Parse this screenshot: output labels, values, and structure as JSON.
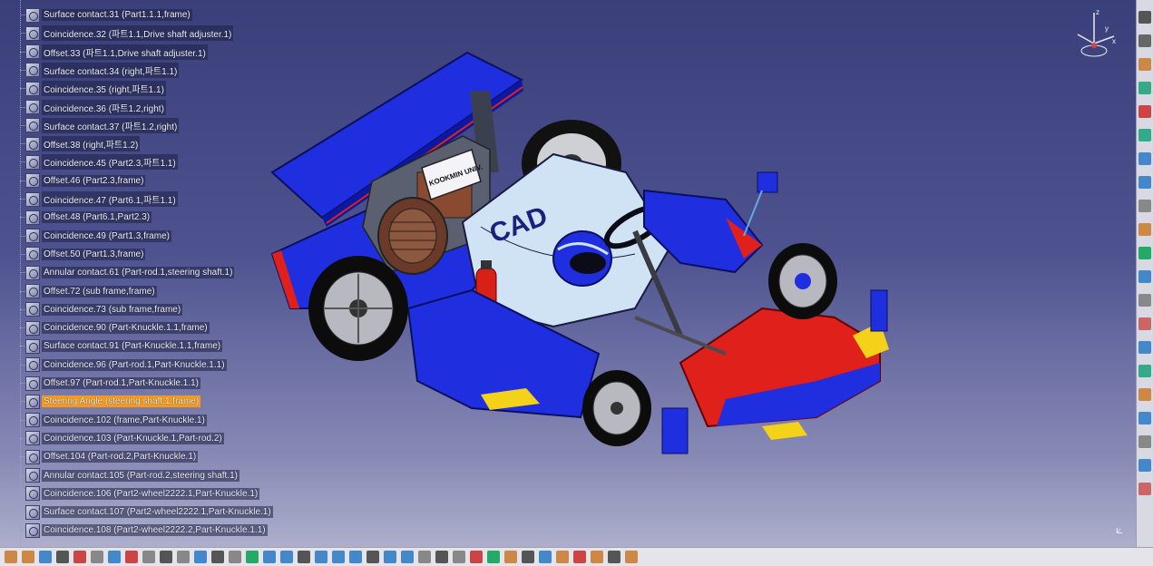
{
  "tree": {
    "items": [
      {
        "label": "Surface contact.31 (Part1.1.1,frame)"
      },
      {
        "label": "Coincidence.32 (파트1.1,Drive shaft adjuster.1)"
      },
      {
        "label": "Offset.33 (파트1.1,Drive shaft adjuster.1)"
      },
      {
        "label": "Surface contact.34 (right,파트1.1)"
      },
      {
        "label": "Coincidence.35 (right,파트1.1)"
      },
      {
        "label": "Coincidence.36 (파트1.2,right)"
      },
      {
        "label": "Surface contact.37 (파트1.2,right)"
      },
      {
        "label": "Offset.38 (right,파트1.2)"
      },
      {
        "label": "Coincidence.45 (Part2.3,파트1.1)"
      },
      {
        "label": "Offset.46 (Part2.3,frame)"
      },
      {
        "label": "Coincidence.47 (Part6.1,파트1.1)"
      },
      {
        "label": "Offset.48 (Part6.1,Part2.3)"
      },
      {
        "label": "Coincidence.49 (Part1.3,frame)"
      },
      {
        "label": "Offset.50 (Part1.3,frame)"
      },
      {
        "label": "Annular contact.61 (Part-rod.1,steering shaft.1)"
      },
      {
        "label": "Offset.72 (sub frame,frame)"
      },
      {
        "label": "Coincidence.73 (sub frame,frame)"
      },
      {
        "label": "Coincidence.90 (Part-Knuckle.1.1,frame)"
      },
      {
        "label": "Surface contact.91 (Part-Knuckle.1.1,frame)"
      },
      {
        "label": "Coincidence.96 (Part-rod.1,Part-Knuckle.1.1)"
      },
      {
        "label": "Offset.97 (Part-rod.1,Part-Knuckle.1.1)"
      },
      {
        "label": "Steering Angle (steering shaft.1,frame)",
        "selected": true
      },
      {
        "label": "Coincidence.102 (frame,Part-Knuckle.1)"
      },
      {
        "label": "Coincidence.103 (Part-Knuckle.1,Part-rod.2)"
      },
      {
        "label": "Offset.104 (Part-rod.2,Part-Knuckle.1)"
      },
      {
        "label": "Annular contact.105 (Part-rod.2,steering shaft.1)"
      },
      {
        "label": "Coincidence.106 (Part2-wheel2222.1,Part-Knuckle.1)"
      },
      {
        "label": "Surface contact.107 (Part2-wheel2222.1,Part-Knuckle.1)"
      },
      {
        "label": "Coincidence.108 (Part2-wheel2222.2,Part-Knuckle.1.1)"
      }
    ]
  },
  "model": {
    "cad_logo": "CAD",
    "sign_text": "KOOKMIN UNIV.",
    "colors": {
      "body": "#1f2fe0",
      "accent": "#e0201a",
      "yellow": "#f5d21a",
      "seat": "#cfe3f4"
    }
  },
  "compass": {
    "x": "x",
    "y": "y",
    "z": "z"
  },
  "colors": {
    "selected": "#f59a1e",
    "background_top": "#3a3f7a",
    "background_bottom": "#b4b6d0"
  }
}
